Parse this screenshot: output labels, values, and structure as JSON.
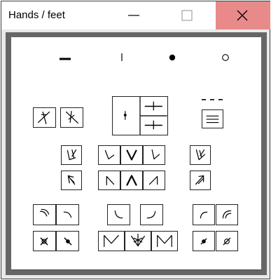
{
  "window": {
    "title": "Hands / feet",
    "accent": "#e88a8a",
    "icons": [
      "minimize-icon",
      "maximize-icon",
      "close-icon"
    ]
  },
  "palette": {
    "top_symbols": [
      "dash-icon",
      "bar-icon",
      "filled-dot-icon",
      "hollow-dot-icon"
    ],
    "buttons": [
      "cross-left-icon",
      "cross-right-icon",
      "split-box-icon",
      "dashed-lines-icon",
      "down-wide-left-icon",
      "down-left-icon",
      "down-center-icon",
      "down-right-icon",
      "down-wide-right-icon",
      "up-wide-left-icon",
      "up-left-icon",
      "up-center-icon",
      "up-right-icon",
      "up-wide-right-icon",
      "curve-a-icon",
      "curve-b-icon",
      "curve-c-icon",
      "curve-d-icon",
      "curve-e-icon",
      "curve-f-icon",
      "x-circle-icon",
      "x-filled-icon",
      "m-open-icon",
      "m-star-icon",
      "m-closed-icon",
      "dot-filled-icon",
      "slash-circle-icon"
    ]
  }
}
